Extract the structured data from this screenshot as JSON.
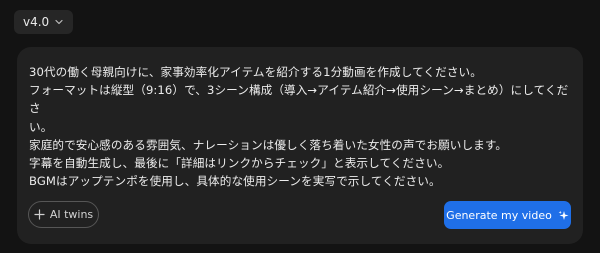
{
  "version_select": {
    "label": "v4.0",
    "icon": "chevron-down-icon"
  },
  "prompt": {
    "lines": [
      "30代の働く母親向けに、家事効率化アイテムを紹介する1分動画を作成してください。",
      "フォーマットは縦型（9:16）で、3シーン構成（導入→アイテム紹介→使用シーン→まとめ）にしてくださ",
      "い。",
      "家庭的で安心感のある雰囲気、ナレーションは優しく落ち着いた女性の声でお願いします。",
      "字幕を自動生成し、最後に「詳細はリンクからチェック」と表示してください。",
      "BGMはアップテンポを使用し、具体的な使用シーンを実写で示してください。"
    ]
  },
  "ai_twins_button": {
    "label": "AI twins",
    "icon": "plus-icon"
  },
  "generate_button": {
    "label": "Generate my video",
    "icon": "sparkle-icon",
    "color": "#1f6fe8"
  },
  "colors": {
    "background": "#131313",
    "card": "#212121",
    "accent": "#1f6fe8"
  }
}
